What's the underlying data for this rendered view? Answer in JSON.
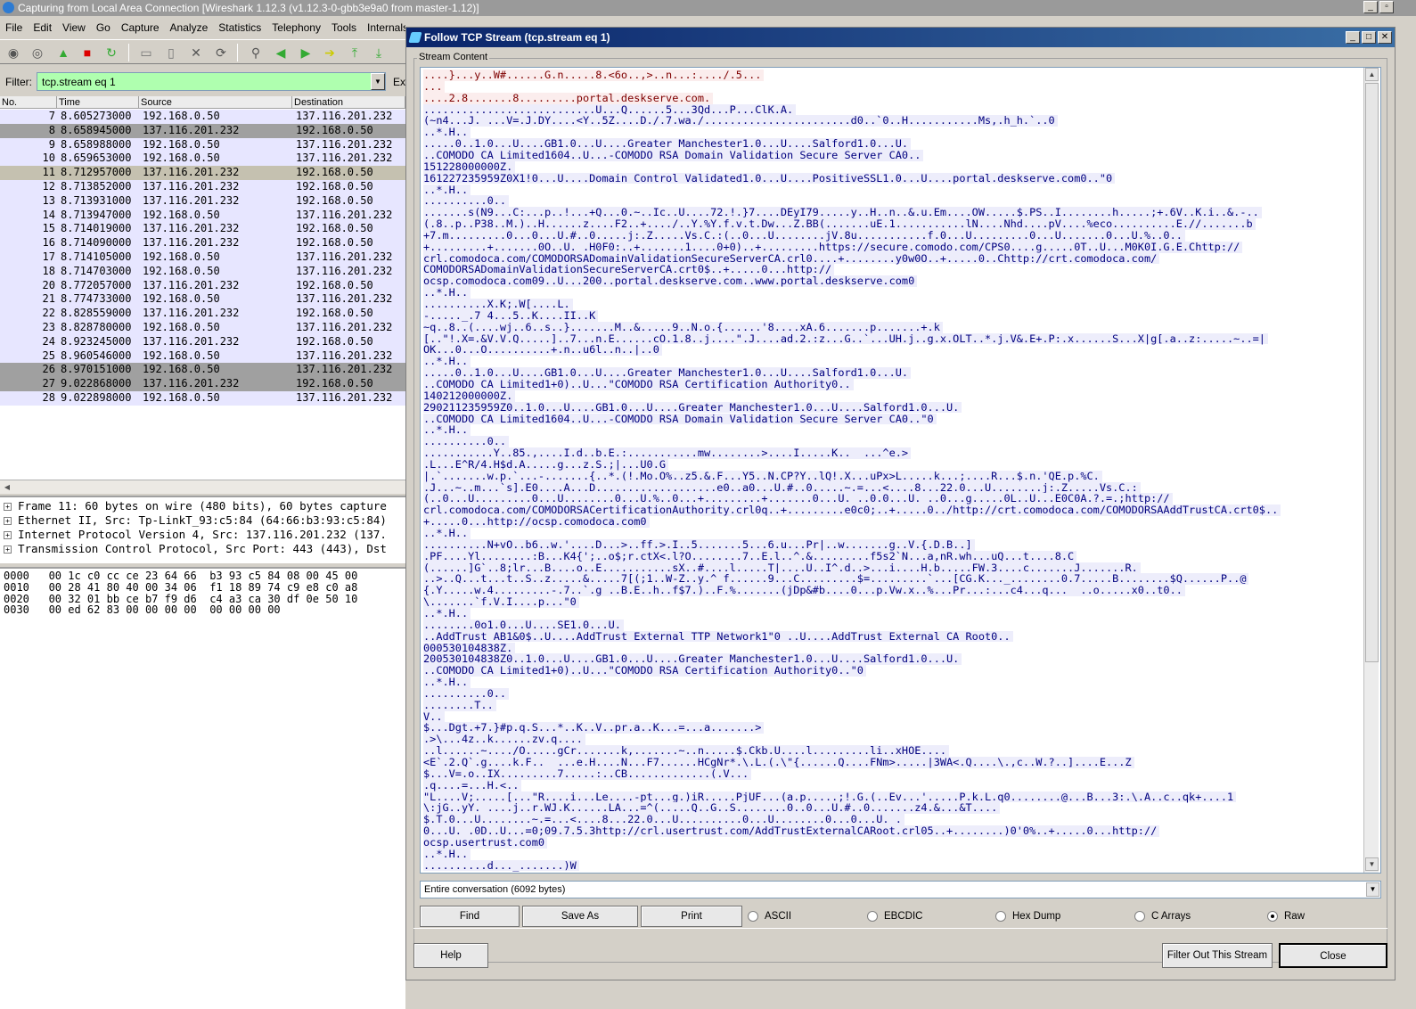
{
  "main_window": {
    "title": "Capturing from Local Area Connection   [Wireshark 1.12.3  (v1.12.3-0-gbb3e9a0 from master-1.12)]",
    "menu": [
      "File",
      "Edit",
      "View",
      "Go",
      "Capture",
      "Analyze",
      "Statistics",
      "Telephony",
      "Tools",
      "Internals"
    ],
    "filter": {
      "label": "Filter:",
      "value": "tcp.stream eq 1",
      "expression_label": "Ex"
    },
    "columns": [
      "No.",
      "Time",
      "Source",
      "Destination"
    ],
    "packets": [
      {
        "no": "7",
        "time": "8.605273000",
        "src": "192.168.0.50",
        "dst": "137.116.201.232",
        "style": "light"
      },
      {
        "no": "8",
        "time": "8.658945000",
        "src": "137.116.201.232",
        "dst": "192.168.0.50",
        "style": "dark"
      },
      {
        "no": "9",
        "time": "8.658988000",
        "src": "192.168.0.50",
        "dst": "137.116.201.232",
        "style": "light"
      },
      {
        "no": "10",
        "time": "8.659653000",
        "src": "192.168.0.50",
        "dst": "137.116.201.232",
        "style": "light"
      },
      {
        "no": "11",
        "time": "8.712957000",
        "src": "137.116.201.232",
        "dst": "192.168.0.50",
        "style": "selected"
      },
      {
        "no": "12",
        "time": "8.713852000",
        "src": "137.116.201.232",
        "dst": "192.168.0.50",
        "style": "light"
      },
      {
        "no": "13",
        "time": "8.713931000",
        "src": "137.116.201.232",
        "dst": "192.168.0.50",
        "style": "light"
      },
      {
        "no": "14",
        "time": "8.713947000",
        "src": "192.168.0.50",
        "dst": "137.116.201.232",
        "style": "light"
      },
      {
        "no": "15",
        "time": "8.714019000",
        "src": "137.116.201.232",
        "dst": "192.168.0.50",
        "style": "light"
      },
      {
        "no": "16",
        "time": "8.714090000",
        "src": "137.116.201.232",
        "dst": "192.168.0.50",
        "style": "light"
      },
      {
        "no": "17",
        "time": "8.714105000",
        "src": "192.168.0.50",
        "dst": "137.116.201.232",
        "style": "light"
      },
      {
        "no": "18",
        "time": "8.714703000",
        "src": "192.168.0.50",
        "dst": "137.116.201.232",
        "style": "light"
      },
      {
        "no": "20",
        "time": "8.772057000",
        "src": "137.116.201.232",
        "dst": "192.168.0.50",
        "style": "light"
      },
      {
        "no": "21",
        "time": "8.774733000",
        "src": "192.168.0.50",
        "dst": "137.116.201.232",
        "style": "light"
      },
      {
        "no": "22",
        "time": "8.828559000",
        "src": "137.116.201.232",
        "dst": "192.168.0.50",
        "style": "light"
      },
      {
        "no": "23",
        "time": "8.828780000",
        "src": "192.168.0.50",
        "dst": "137.116.201.232",
        "style": "light"
      },
      {
        "no": "24",
        "time": "8.923245000",
        "src": "137.116.201.232",
        "dst": "192.168.0.50",
        "style": "light"
      },
      {
        "no": "25",
        "time": "8.960546000",
        "src": "192.168.0.50",
        "dst": "137.116.201.232",
        "style": "light"
      },
      {
        "no": "26",
        "time": "8.970151000",
        "src": "192.168.0.50",
        "dst": "137.116.201.232",
        "style": "dark"
      },
      {
        "no": "27",
        "time": "9.022868000",
        "src": "137.116.201.232",
        "dst": "192.168.0.50",
        "style": "dark"
      },
      {
        "no": "28",
        "time": "9.022898000",
        "src": "192.168.0.50",
        "dst": "137.116.201.232",
        "style": "light"
      }
    ],
    "details": [
      "Frame 11: 60 bytes on wire (480 bits), 60 bytes capture",
      "Ethernet II, Src: Tp-LinkT_93:c5:84 (64:66:b3:93:c5:84)",
      "Internet Protocol Version 4, Src: 137.116.201.232 (137.",
      "Transmission Control Protocol, Src Port: 443 (443), Dst"
    ],
    "hex": [
      "0000   00 1c c0 cc ce 23 64 66  b3 93 c5 84 08 00 45 00",
      "0010   00 28 41 80 40 00 34 06  f1 18 89 74 c9 e8 c0 a8",
      "0020   00 32 01 bb ce b7 f9 d6  c4 a3 ca 30 df 0e 50 10",
      "0030   00 ed 62 83 00 00 00 00  00 00 00 00"
    ]
  },
  "dialog": {
    "title": "Follow TCP Stream (tcp.stream eq 1)",
    "group_label": "Stream Content",
    "colors": {
      "client_fg": "#7f0000",
      "client_bg": "#fbeded",
      "server_fg": "#00007f",
      "server_bg": "#ededfb"
    },
    "stream_lines": [
      {
        "t": "....}...y..W#......G.n.....8.<6o..,>..n...:..../.5...",
        "c": "c"
      },
      {
        "t": "...",
        "c": "c"
      },
      {
        "t": "....2.8.......8.........portal.deskserve.com.",
        "c": "c"
      },
      {
        "t": "...........................U...Q......5...3Qd...P...ClK.A.",
        "c": "s"
      },
      {
        "t": "(~n4...J. ...V=.J.DY....<Y..5Z....D./.7.wa./.......................d0..`0..H...........Ms,.h_h.`..0",
        "c": "s"
      },
      {
        "t": "..*.H..",
        "c": "s"
      },
      {
        "t": ".....0..1.0...U....GB1.0...U....Greater Manchester1.0...U....Salford1.0...U.",
        "c": "s"
      },
      {
        "t": "..COMODO CA Limited1604..U...-COMODO RSA Domain Validation Secure Server CA0..",
        "c": "s"
      },
      {
        "t": "151228000000Z.",
        "c": "s"
      },
      {
        "t": "161227235959Z0X1!0...U....Domain Control Validated1.0...U....PositiveSSL1.0...U....portal.deskserve.com0..\"0",
        "c": "s"
      },
      {
        "t": "..*.H..",
        "c": "s"
      },
      {
        "t": "..........0..",
        "c": "s"
      },
      {
        "t": ".......s(N9...C:...p..!...+Q...0.~..Ic..U....72.!.}7....DEyI79.....y..H..n..&.u.Em....OW.....$.PS..I........h.....;+.6V..K.i..&.-..",
        "c": "s"
      },
      {
        "t": "(.8..p..P38..M.)..H......z....F2..+..../..Y.%Y.f.v.t.Dw...Z.BB(.......uE.1...........lN....Nhd....pV....%eco..........E.//.......b",
        "c": "s"
      },
      {
        "t": "+7.m.........0...0...U.#..0.....j:.Z.....Vs.C.:(..0...U........jV.8u...........f.0...U.........0...U.......0...U.%..0..",
        "c": "s"
      },
      {
        "t": "+.........+.......0O..U. .H0F0:..+.......1....0+0)..+.........https://secure.comodo.com/CPS0....g.....0T..U...M0K0I.G.E.Chttp://",
        "c": "s"
      },
      {
        "t": "crl.comodoca.com/COMODORSADomainValidationSecureServerCA.crl0....+........y0w0O..+.....0..Chttp://crt.comodoca.com/",
        "c": "s"
      },
      {
        "t": "COMODORSADomainValidationSecureServerCA.crt0$..+.....0...http://",
        "c": "s"
      },
      {
        "t": "ocsp.comodoca.com09..U...200..portal.deskserve.com..www.portal.deskserve.com0",
        "c": "s"
      },
      {
        "t": "..*.H..",
        "c": "s"
      },
      {
        "t": "..........X.K;.W[....L.",
        "c": "s"
      },
      {
        "t": "-....._.7 4...5..K....II..K",
        "c": "s"
      },
      {
        "t": "~q..8..(....wj..6..s..}.......M..&.....9..N.o.{......'8....xA.6.......p.......+.k",
        "c": "s"
      },
      {
        "t": "[..\"!.X=.&V.V.Q.....]..7...n.E......cO.1.8..j....\".J....ad.2.:z...G..`...UH.j..g.x.OLT..*.j.V&.E+.P:.x......S...X|g[.a..z:.....~..=|",
        "c": "s"
      },
      {
        "t": "OK...0...O..........+.n..u6l..n..|..0",
        "c": "s"
      },
      {
        "t": "..*.H..",
        "c": "s"
      },
      {
        "t": ".....0..1.0...U....GB1.0...U....Greater Manchester1.0...U....Salford1.0...U.",
        "c": "s"
      },
      {
        "t": "..COMODO CA Limited1+0)..U...\"COMODO RSA Certification Authority0..",
        "c": "s"
      },
      {
        "t": "140212000000Z.",
        "c": "s"
      },
      {
        "t": "290211235959Z0..1.0...U....GB1.0...U....Greater Manchester1.0...U....Salford1.0...U.",
        "c": "s"
      },
      {
        "t": "..COMODO CA Limited1604..U...-COMODO RSA Domain Validation Secure Server CA0..\"0",
        "c": "s"
      },
      {
        "t": "..*.H..",
        "c": "s"
      },
      {
        "t": "..........0..",
        "c": "s"
      },
      {
        "t": "...........Y..85.,....I.d..b.E.:...........mw........>....I.....K..  ...^e.>",
        "c": "s"
      },
      {
        "t": ".L...E^R/4.H$d.A.....g...z.S.;|...U0.G",
        "c": "s"
      },
      {
        "t": "|.`.......w.p.`...-.......{..*.(!.Mo.O%..z5.&.F...Y5..N.CP?Y..lQ!.X...uPx>L.....k...;....R...$.n.'QE.p.%C.",
        "c": "s"
      },
      {
        "t": ".J...~..m...`s].E0....A...D...................e0..a0...U.#..0.....~.=...<....8...22.0...U........j:.Z.....Vs.C.:",
        "c": "s"
      },
      {
        "t": "(..0...U.........0...U........0...U.%..0...+.........+.......0...U. ..0.0...U. ..0...g.....0L..U...E0C0A.?.=.;http://",
        "c": "s"
      },
      {
        "t": "crl.comodoca.com/COMODORSACertificationAuthority.crl0q..+.........e0c0;..+.....0../http://crt.comodoca.com/COMODORSAAddTrustCA.crt0$..",
        "c": "s"
      },
      {
        "t": "+.....0...http://ocsp.comodoca.com0",
        "c": "s"
      },
      {
        "t": "..*.H..",
        "c": "s"
      },
      {
        "t": "..........N+vO..b6..w.'....D...>..ff.>.I..5.......5...6.u...Pr|..w.......g..V.{.D.B..]",
        "c": "s"
      },
      {
        "t": ".PF....Yl........:B...K4{';..o$;r.ctX<.l?O........7..E.l..^.&.........f5s2`N...a,nR.wh...uQ...t....8.C",
        "c": "s"
      },
      {
        "t": "(......]G`..8;lr...B....o..E...........sX..#....l.....T|....U..I^.d..>...i....H.b.....FW.3....c.......J.......R.",
        "c": "s"
      },
      {
        "t": "..>..Q...t...t..S..z.....&.....7[(;1..W-Z..y.^ f......9...C.........$=.........`...[CG.K..._........0.7.....B........$Q......P..@",
        "c": "s"
      },
      {
        "t": "{.Y.....w.4.........-.7..`.g ..B.E..h..f$7.)..F.%.......(jDp&#b....0...p.Vw.x..%...Pr...:...c4...q...  ..o.....x0..t0..",
        "c": "s"
      },
      {
        "t": "\\.......`f.V.I....p...\"0",
        "c": "s"
      },
      {
        "t": "..*.H..",
        "c": "s"
      },
      {
        "t": "........0o1.0...U....SE1.0...U.",
        "c": "s"
      },
      {
        "t": "..AddTrust AB1&0$..U....AddTrust External TTP Network1\"0 ..U....AddTrust External CA Root0..",
        "c": "s"
      },
      {
        "t": "000530104838Z.",
        "c": "s"
      },
      {
        "t": "200530104838Z0..1.0...U....GB1.0...U....Greater Manchester1.0...U....Salford1.0...U.",
        "c": "s"
      },
      {
        "t": "..COMODO CA Limited1+0)..U...\"COMODO RSA Certification Authority0..\"0",
        "c": "s"
      },
      {
        "t": "..*.H..",
        "c": "s"
      },
      {
        "t": "..........0..",
        "c": "s"
      },
      {
        "t": "........T..",
        "c": "s"
      },
      {
        "t": "V..",
        "c": "s"
      },
      {
        "t": "$...Dgt.+7.}#p.q.S...*..K..V..pr.a..K...=...a.......>",
        "c": "s"
      },
      {
        "t": ".>\\...4z..k......zv.q....",
        "c": "s"
      },
      {
        "t": "..l......~..../O.....gCr.......k,.......~..n.....$.Ckb.U....l.........li..xHOE....",
        "c": "s"
      },
      {
        "t": "<E`.2.Q`.g....k.F..  ...e.H....N...F7......HCgNr*.\\.L.(.\\\"{......Q....FNm>.....|3WA<.Q....\\.,c..W.?..]....E...Z",
        "c": "s"
      },
      {
        "t": "$...V=.o..IX.........7.....:..CB.............(.V...",
        "c": "s"
      },
      {
        "t": ".q....=...H.<..",
        "c": "s"
      },
      {
        "t": "\"L....V;.....[...\"R....i...Le....-pt...g.)iR.....PjUF...(a.p.....;!.G.(..Ev...'.....P.k.L.q0........@...B...3:.\\.A..c..qk+....1",
        "c": "s"
      },
      {
        "t": "\\:jG..yY. ....j..r.WJ.K......LA...=^(.....Q..G..S........0..0...U.#..0.......z4.&...&T....",
        "c": "s"
      },
      {
        "t": "$.T.0...U........~.=...<....8...22.0...U..........0...U........0...0...U. .",
        "c": "s"
      },
      {
        "t": "0...U. .0D..U...=0;09.7.5.3http://crl.usertrust.com/AddTrustExternalCARoot.crl05..+........)0'0%..+.....0...http://",
        "c": "s"
      },
      {
        "t": "ocsp.usertrust.com0",
        "c": "s"
      },
      {
        "t": "..*.H..",
        "c": "s"
      },
      {
        "t": "..........d..._.......)W",
        "c": "s"
      }
    ],
    "conversation": "Entire conversation (6092 bytes)",
    "buttons": {
      "find": "Find",
      "save_as": "Save As",
      "print": "Print",
      "help": "Help",
      "filter_out": "Filter Out This Stream",
      "close": "Close"
    },
    "formats": [
      {
        "label": "ASCII",
        "selected": false
      },
      {
        "label": "EBCDIC",
        "selected": false
      },
      {
        "label": "Hex Dump",
        "selected": false
      },
      {
        "label": "C Arrays",
        "selected": false
      },
      {
        "label": "Raw",
        "selected": true
      }
    ]
  }
}
